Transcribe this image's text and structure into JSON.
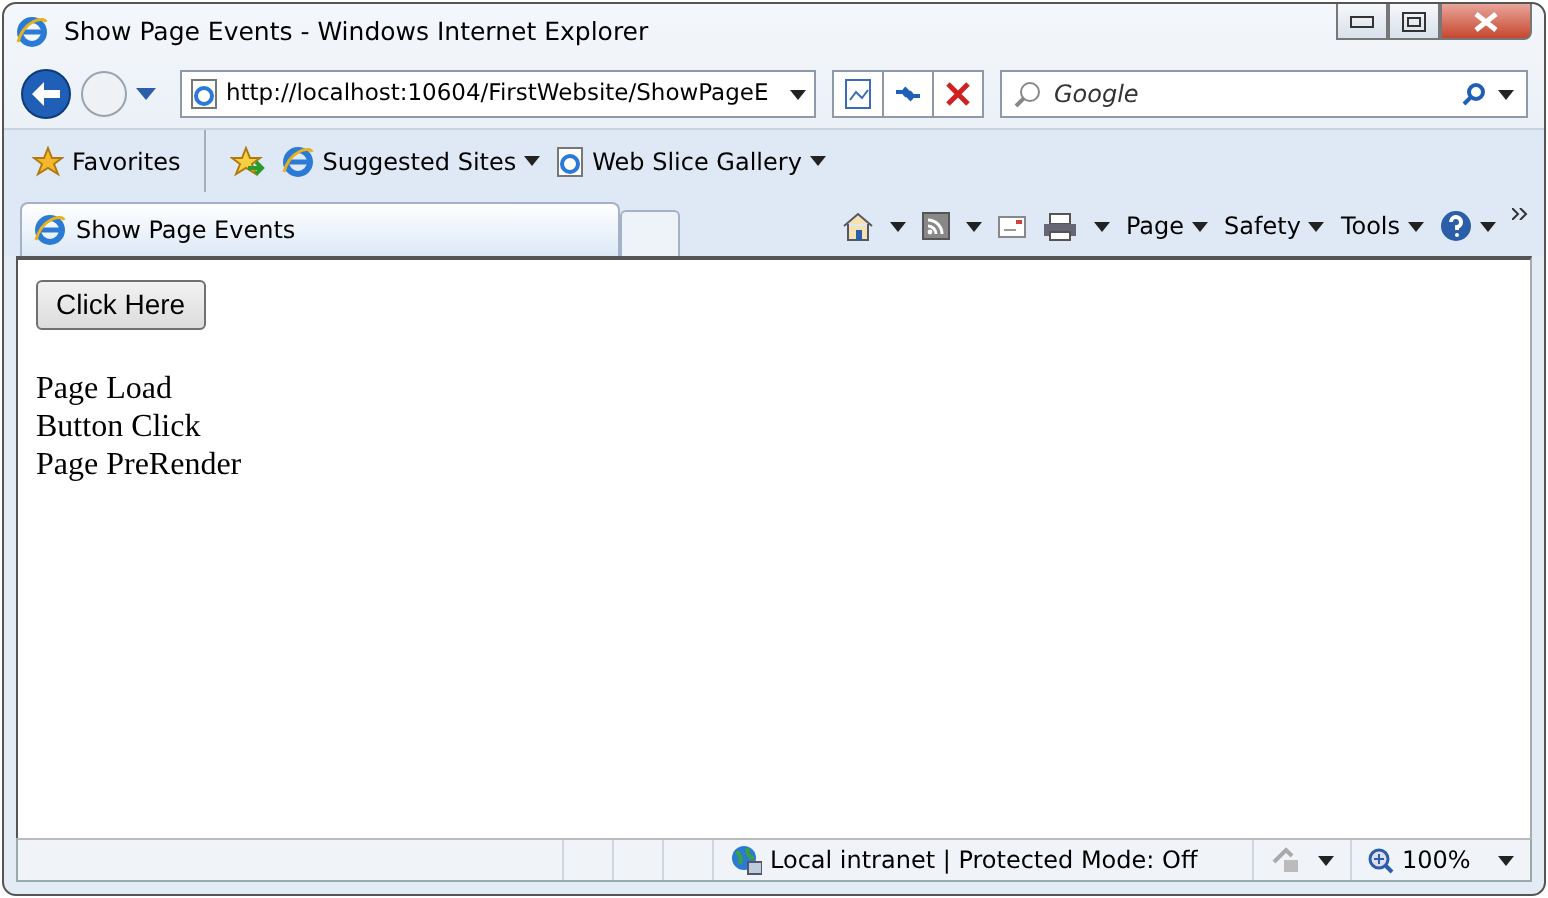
{
  "window": {
    "title": "Show Page Events - Windows Internet Explorer"
  },
  "address_bar": {
    "url": "http://localhost:10604/FirstWebsite/ShowPageE"
  },
  "search": {
    "placeholder": "Google"
  },
  "favorites_bar": {
    "label": "Favorites",
    "links": [
      {
        "label": "Suggested Sites",
        "kind": "site"
      },
      {
        "label": "Web Slice Gallery",
        "kind": "page"
      }
    ]
  },
  "tabs": [
    {
      "label": "Show Page Events",
      "selected": true
    }
  ],
  "command_bar": {
    "menus": [
      "Page",
      "Safety",
      "Tools"
    ]
  },
  "page": {
    "button": "Click Here",
    "lines": [
      "Page Load",
      "Button Click",
      "Page PreRender"
    ]
  },
  "status_bar": {
    "zone": "Local intranet | Protected Mode: Off",
    "zoom": "100%"
  }
}
